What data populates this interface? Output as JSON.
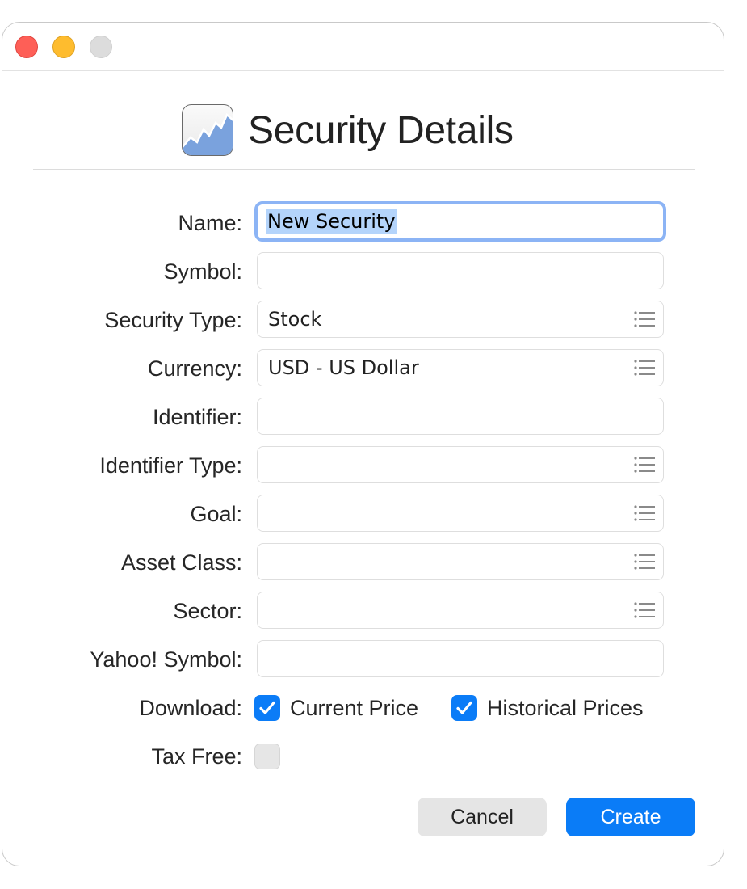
{
  "window": {
    "title": "Security Details"
  },
  "form": {
    "name": {
      "label": "Name:",
      "value": "New Security"
    },
    "symbol": {
      "label": "Symbol:",
      "value": ""
    },
    "security_type": {
      "label": "Security Type:",
      "value": "Stock"
    },
    "currency": {
      "label": "Currency:",
      "value": "USD - US Dollar"
    },
    "identifier": {
      "label": "Identifier:",
      "value": ""
    },
    "identifier_type": {
      "label": "Identifier Type:",
      "value": ""
    },
    "goal": {
      "label": "Goal:",
      "value": ""
    },
    "asset_class": {
      "label": "Asset Class:",
      "value": ""
    },
    "sector": {
      "label": "Sector:",
      "value": ""
    },
    "yahoo_symbol": {
      "label": "Yahoo! Symbol:",
      "value": ""
    },
    "download": {
      "label": "Download:",
      "current_price": {
        "label": "Current Price",
        "checked": true
      },
      "historical_prices": {
        "label": "Historical Prices",
        "checked": true
      }
    },
    "tax_free": {
      "label": "Tax Free:",
      "checked": false
    }
  },
  "buttons": {
    "cancel": "Cancel",
    "create": "Create"
  },
  "icons": {
    "app": "chart-area-icon",
    "popup": "list-icon",
    "checkmark": "checkmark-icon"
  },
  "colors": {
    "accent": "#0a7cf7",
    "focus_ring": "#8cb4f5",
    "selection": "#b4d4fb",
    "close": "#fe5f57",
    "minimize": "#febc2e",
    "zoom_inactive": "#dcdcdc"
  }
}
